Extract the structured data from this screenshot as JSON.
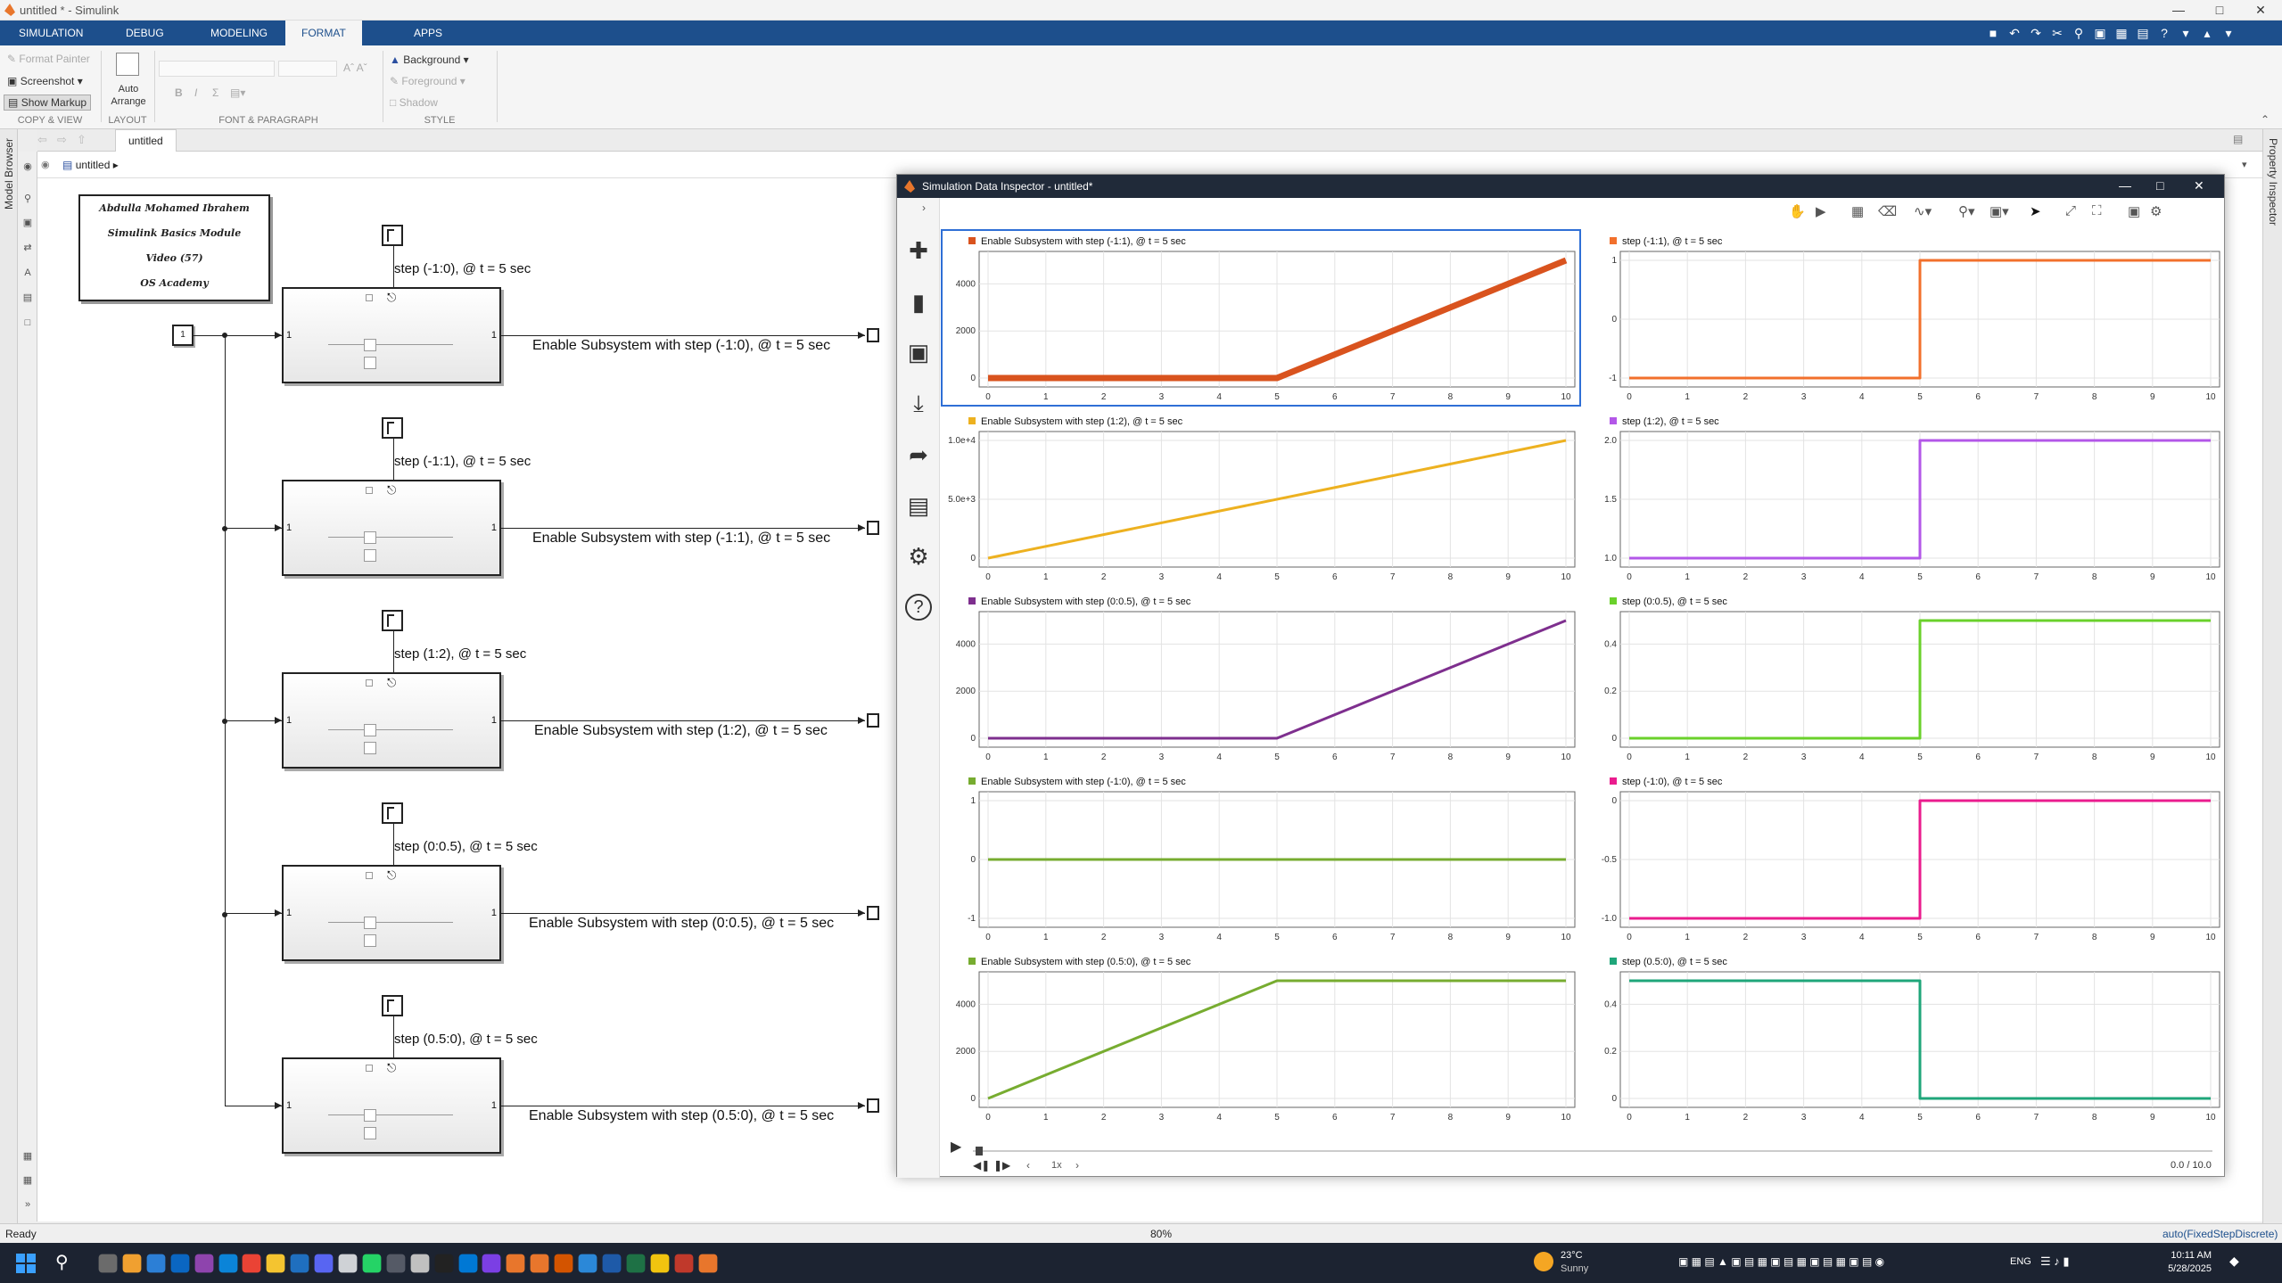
{
  "window": {
    "title": "untitled * - Simulink"
  },
  "ribbon_tabs": [
    "SIMULATION",
    "DEBUG",
    "MODELING",
    "FORMAT",
    "APPS"
  ],
  "ribbon": {
    "format_painter": "Format Painter",
    "screenshot": "Screenshot",
    "show_markup": "Show Markup",
    "copy_view": "COPY & VIEW",
    "auto_arrange_1": "Auto",
    "auto_arrange_2": "Arrange",
    "layout": "LAYOUT",
    "font_paragraph": "FONT & PARAGRAPH",
    "background": "Background",
    "foreground": "Foreground",
    "shadow": "Shadow",
    "style": "STYLE",
    "bold": "B",
    "italic": "I",
    "sigma": "Σ"
  },
  "model_tab": "untitled",
  "breadcrumb": "untitled",
  "left_panel": "Model Browser",
  "right_panel": "Property Inspector",
  "note": [
    "Abdulla Mohamed Ibrahem",
    "Simulink Basics Module",
    "Video (57)",
    "OS Academy"
  ],
  "source_block": "1",
  "subsystems": [
    {
      "step_label": "step (-1:0), @ t = 5 sec",
      "output_label": "Enable Subsystem with step (-1:0), @ t = 5 sec"
    },
    {
      "step_label": "step (-1:1), @ t = 5 sec",
      "output_label": "Enable Subsystem with step (-1:1), @ t = 5 sec"
    },
    {
      "step_label": "step (1:2), @ t = 5 sec",
      "output_label": "Enable Subsystem with step (1:2), @ t = 5 sec"
    },
    {
      "step_label": "step (0:0.5), @ t = 5 sec",
      "output_label": "Enable Subsystem with step (0:0.5), @ t = 5 sec"
    },
    {
      "step_label": "step (0.5:0), @ t = 5 sec",
      "output_label": "Enable Subsystem with step (0.5:0), @ t = 5 sec"
    }
  ],
  "port_in": "1",
  "port_out": "1",
  "sdi": {
    "title": "Simulation Data Inspector - untitled*",
    "speed": "1x",
    "time": "0.0 / 10.0"
  },
  "chart_data": [
    {
      "type": "line",
      "title": "Enable Subsystem with step (-1:1), @ t = 5 sec",
      "color": "#d9531e",
      "x": [
        0,
        5,
        10
      ],
      "y": [
        0,
        0,
        5000
      ],
      "xlim": [
        0,
        10
      ],
      "ylim": [
        0,
        5000
      ],
      "yticks": [
        "0",
        "2000",
        "4000"
      ],
      "ytick_values": [
        0,
        2000,
        4000
      ],
      "xticks": [
        "0",
        "1",
        "2",
        "3",
        "4",
        "5",
        "6",
        "7",
        "8",
        "9",
        "10"
      ],
      "lw": 7,
      "selected": true
    },
    {
      "type": "line",
      "title": "step (-1:1), @ t = 5 sec",
      "color": "#f2702c",
      "x": [
        0,
        5,
        5,
        10
      ],
      "y": [
        -1,
        -1,
        1,
        1
      ],
      "xlim": [
        0,
        10
      ],
      "ylim": [
        -1,
        1
      ],
      "yticks": [
        "-1",
        "0",
        "1"
      ],
      "ytick_values": [
        -1,
        0,
        1
      ],
      "xticks": [
        "0",
        "1",
        "2",
        "3",
        "4",
        "5",
        "6",
        "7",
        "8",
        "9",
        "10"
      ],
      "lw": 3
    },
    {
      "type": "line",
      "title": "Enable Subsystem with step (1:2), @ t = 5 sec",
      "color": "#edb120",
      "x": [
        0,
        10
      ],
      "y": [
        0,
        10000
      ],
      "xlim": [
        0,
        10
      ],
      "ylim": [
        0,
        10000
      ],
      "yticks": [
        "0",
        "5.0e+3",
        "1.0e+4"
      ],
      "ytick_values": [
        0,
        5000,
        10000
      ],
      "xticks": [
        "0",
        "1",
        "2",
        "3",
        "4",
        "5",
        "6",
        "7",
        "8",
        "9",
        "10"
      ],
      "lw": 3
    },
    {
      "type": "line",
      "title": "step (1:2), @ t = 5 sec",
      "color": "#b357e8",
      "x": [
        0,
        5,
        5,
        10
      ],
      "y": [
        1,
        1,
        2,
        2
      ],
      "xlim": [
        0,
        10
      ],
      "ylim": [
        1,
        2
      ],
      "yticks": [
        "1.0",
        "1.5",
        "2.0"
      ],
      "ytick_values": [
        1,
        1.5,
        2
      ],
      "xticks": [
        "0",
        "1",
        "2",
        "3",
        "4",
        "5",
        "6",
        "7",
        "8",
        "9",
        "10"
      ],
      "lw": 3
    },
    {
      "type": "line",
      "title": "Enable Subsystem with step (0:0.5), @ t = 5 sec",
      "color": "#7e2f8e",
      "x": [
        0,
        5,
        10
      ],
      "y": [
        0,
        0,
        5000
      ],
      "xlim": [
        0,
        10
      ],
      "ylim": [
        0,
        5000
      ],
      "yticks": [
        "0",
        "2000",
        "4000"
      ],
      "ytick_values": [
        0,
        2000,
        4000
      ],
      "xticks": [
        "0",
        "1",
        "2",
        "3",
        "4",
        "5",
        "6",
        "7",
        "8",
        "9",
        "10"
      ],
      "lw": 3
    },
    {
      "type": "line",
      "title": "step (0:0.5), @ t = 5 sec",
      "color": "#6ad12b",
      "x": [
        0,
        5,
        5,
        10
      ],
      "y": [
        0,
        0,
        0.5,
        0.5
      ],
      "xlim": [
        0,
        10
      ],
      "ylim": [
        0,
        0.5
      ],
      "yticks": [
        "0",
        "0.2",
        "0.4"
      ],
      "ytick_values": [
        0,
        0.2,
        0.4
      ],
      "xticks": [
        "0",
        "1",
        "2",
        "3",
        "4",
        "5",
        "6",
        "7",
        "8",
        "9",
        "10"
      ],
      "lw": 3
    },
    {
      "type": "line",
      "title": "Enable Subsystem with step (-1:0), @ t = 5 sec",
      "color": "#77ac30",
      "x": [
        0,
        10
      ],
      "y": [
        0,
        0
      ],
      "xlim": [
        0,
        10
      ],
      "ylim": [
        -1,
        1
      ],
      "yticks": [
        "-1",
        "0",
        "1"
      ],
      "ytick_values": [
        -1,
        0,
        1
      ],
      "xticks": [
        "0",
        "1",
        "2",
        "3",
        "4",
        "5",
        "6",
        "7",
        "8",
        "9",
        "10"
      ],
      "lw": 3
    },
    {
      "type": "line",
      "title": "step (-1:0), @ t = 5 sec",
      "color": "#ea1c8e",
      "x": [
        0,
        5,
        5,
        10
      ],
      "y": [
        -1,
        -1,
        0,
        0
      ],
      "xlim": [
        0,
        10
      ],
      "ylim": [
        -1,
        0
      ],
      "yticks": [
        "-1.0",
        "-0.5",
        "0"
      ],
      "ytick_values": [
        -1,
        -0.5,
        0
      ],
      "xticks": [
        "0",
        "1",
        "2",
        "3",
        "4",
        "5",
        "6",
        "7",
        "8",
        "9",
        "10"
      ],
      "lw": 3
    },
    {
      "type": "line",
      "title": "Enable Subsystem with step (0.5:0), @ t = 5 sec",
      "color": "#77ac30",
      "x": [
        0,
        5,
        10
      ],
      "y": [
        0,
        5000,
        5000
      ],
      "xlim": [
        0,
        10
      ],
      "ylim": [
        0,
        5000
      ],
      "yticks": [
        "0",
        "2000",
        "4000"
      ],
      "ytick_values": [
        0,
        2000,
        4000
      ],
      "xticks": [
        "0",
        "1",
        "2",
        "3",
        "4",
        "5",
        "6",
        "7",
        "8",
        "9",
        "10"
      ],
      "lw": 3
    },
    {
      "type": "line",
      "title": "step (0.5:0), @ t = 5 sec",
      "color": "#1fa67a",
      "x": [
        0,
        5,
        5,
        10
      ],
      "y": [
        0.5,
        0.5,
        0,
        0
      ],
      "xlim": [
        0,
        10
      ],
      "ylim": [
        0,
        0.5
      ],
      "yticks": [
        "0",
        "0.2",
        "0.4"
      ],
      "ytick_values": [
        0,
        0.2,
        0.4
      ],
      "xticks": [
        "0",
        "1",
        "2",
        "3",
        "4",
        "5",
        "6",
        "7",
        "8",
        "9",
        "10"
      ],
      "lw": 3
    }
  ],
  "status": {
    "left": "Ready",
    "center": "80%",
    "right": "auto(FixedStepDiscrete)"
  },
  "taskbar": {
    "temp": "23°C",
    "weather": "Sunny",
    "lang": "ENG",
    "time": "10:11 AM",
    "date": "5/28/2025"
  }
}
